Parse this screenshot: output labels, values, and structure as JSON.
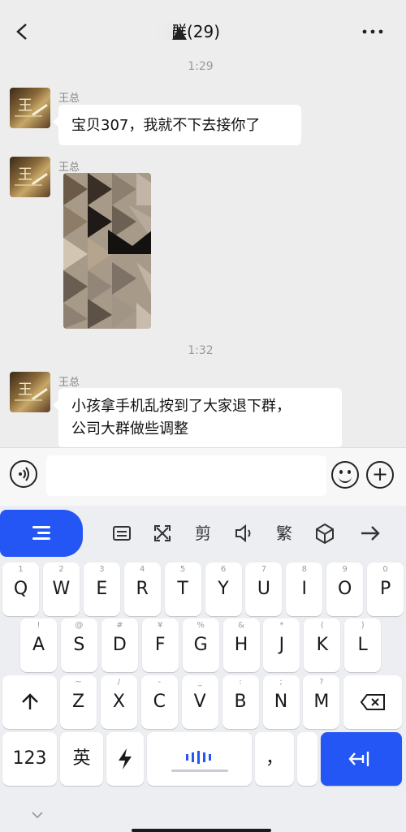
{
  "header": {
    "back_icon": "chevron-left-icon",
    "title": "销售群(29)",
    "more_icon": "more-icon"
  },
  "chat": {
    "messages": [
      {
        "time": "1:29",
        "sender": "王总",
        "type": "text",
        "text": "宝贝307，我就不下去接你了"
      },
      {
        "sender": "王总",
        "type": "image",
        "image_note": "pixelated-photo"
      },
      {
        "time": "1:32",
        "sender": "王总",
        "type": "text",
        "text": "小孩拿手机乱按到了大家退下群，公司大群做些调整",
        "lines": [
          "小孩拿手机乱按到了大家退下群，",
          "公司大群做些调整"
        ]
      }
    ]
  },
  "input_bar": {
    "voice_icon": "voice-icon",
    "text_value": "",
    "emoji_icon": "emoji-icon",
    "plus_icon": "plus-icon"
  },
  "keyboard": {
    "toolbar": [
      {
        "name": "keyboard-menu",
        "icon": "menu-lines-icon"
      },
      {
        "name": "clipboard",
        "icon": "clipboard-icon"
      },
      {
        "name": "resize",
        "icon": "expand-icon"
      },
      {
        "name": "cut",
        "label": "剪"
      },
      {
        "name": "voice-output",
        "icon": "speaker-icon"
      },
      {
        "name": "traditional",
        "label": "繁"
      },
      {
        "name": "skin",
        "icon": "cube-icon"
      },
      {
        "name": "arrow",
        "icon": "arrow-right-icon"
      }
    ],
    "rows": [
      [
        {
          "l": "Q",
          "s": "1"
        },
        {
          "l": "W",
          "s": "2"
        },
        {
          "l": "E",
          "s": "3"
        },
        {
          "l": "R",
          "s": "4"
        },
        {
          "l": "T",
          "s": "5"
        },
        {
          "l": "Y",
          "s": "6"
        },
        {
          "l": "U",
          "s": "7"
        },
        {
          "l": "I",
          "s": "8"
        },
        {
          "l": "O",
          "s": "9"
        },
        {
          "l": "P",
          "s": "0"
        }
      ],
      [
        {
          "l": "A",
          "s": "!"
        },
        {
          "l": "S",
          "s": "@"
        },
        {
          "l": "D",
          "s": "#"
        },
        {
          "l": "F",
          "s": "¥"
        },
        {
          "l": "G",
          "s": "%"
        },
        {
          "l": "H",
          "s": "&"
        },
        {
          "l": "J",
          "s": "*"
        },
        {
          "l": "K",
          "s": "("
        },
        {
          "l": "L",
          "s": ")"
        }
      ],
      [
        {
          "l": "Z",
          "s": "~"
        },
        {
          "l": "X",
          "s": "/"
        },
        {
          "l": "C",
          "s": "-"
        },
        {
          "l": "V",
          "s": "_"
        },
        {
          "l": "B",
          "s": ":"
        },
        {
          "l": "N",
          "s": ";"
        },
        {
          "l": "M",
          "s": "?"
        }
      ]
    ],
    "shift_icon": "shift-icon",
    "delete_icon": "backspace-icon",
    "bottom": {
      "num_label": "123",
      "lang_label": "英",
      "quick_icon": "lightning-icon",
      "space_icon": "voice-wave-icon",
      "punct_label": "，",
      "enter_icon": "enter-icon"
    }
  },
  "colors": {
    "accent": "#2456f5",
    "bg": "#ededed",
    "bubble": "#ffffff"
  }
}
